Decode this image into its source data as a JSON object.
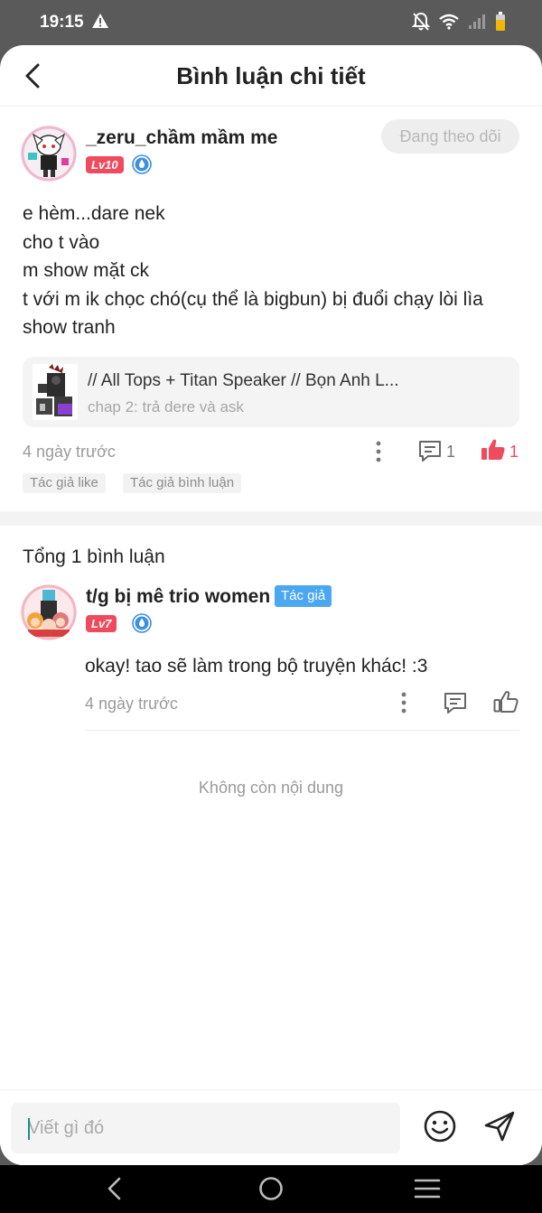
{
  "status_bar": {
    "time": "19:15"
  },
  "header": {
    "title": "Bình luận chi tiết"
  },
  "main_comment": {
    "username": "_zeru_chầm mầm me",
    "level": "Lv10",
    "follow_label": "Đang theo dõi",
    "lines": [
      "e hèm...dare nek",
      "cho t vào",
      "m show mặt ck",
      "t với m ik chọc chó(cụ thể là bigbun) bị đuổi chạy lòi lìa",
      "show tranh"
    ],
    "story": {
      "title": "// All Tops + Titan Speaker // Bọn Anh L...",
      "chapter": "chap 2: trả dere và ask"
    },
    "time": "4 ngày trước",
    "reply_count": "1",
    "like_count": "1",
    "tags": [
      "Tác giả like",
      "Tác giả bình luận"
    ]
  },
  "replies_section": {
    "total_label": "Tổng 1 bình luận",
    "end_label": "Không còn nội dung"
  },
  "reply": {
    "username": "t/g bị mê trio women",
    "author_tag": "Tác giả",
    "level": "Lv7",
    "text": "okay! tao sẽ làm trong bộ truyện khác! :3",
    "time": "4 ngày trước"
  },
  "composer": {
    "placeholder": "Viết gì đó"
  },
  "colors": {
    "accent_like": "#ef4a5e",
    "author_tag": "#4aa7f0",
    "verify": "#3d8fe0"
  },
  "icons": {
    "back": "chevron-left-icon",
    "warning": "warning-icon",
    "verify": "verified-drop-icon",
    "more": "more-vertical-icon",
    "comment": "comment-icon",
    "like": "thumbs-up-icon",
    "emoji": "emoji-icon",
    "send": "send-icon"
  }
}
